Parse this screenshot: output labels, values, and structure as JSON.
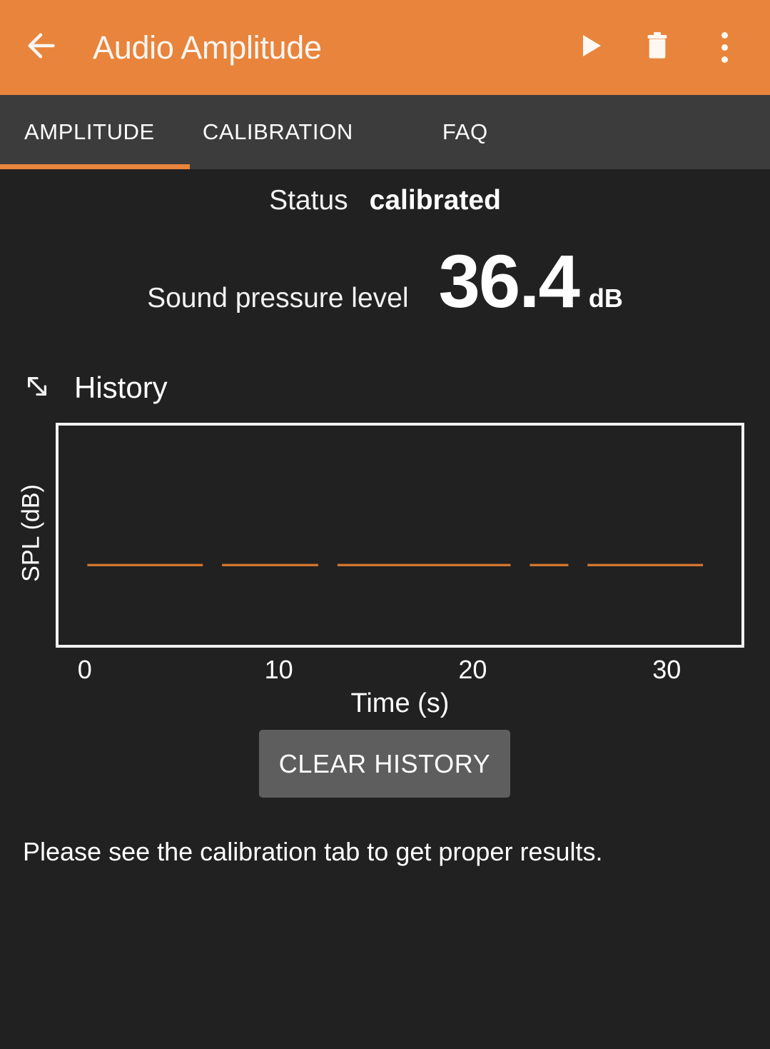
{
  "appbar": {
    "back_icon": "arrow-left-icon",
    "title": "Audio Amplitude",
    "actions": [
      {
        "name": "play-icon",
        "label": "Play"
      },
      {
        "name": "delete-icon",
        "label": "Delete"
      },
      {
        "name": "overflow-menu-icon",
        "label": "More options"
      }
    ],
    "bg_color": "#E8843C",
    "text_color": "#FAF6F2"
  },
  "tabs": {
    "items": [
      {
        "label": "AMPLITUDE",
        "selected": true
      },
      {
        "label": "CALIBRATION",
        "selected": false
      },
      {
        "label": "FAQ",
        "selected": false
      }
    ],
    "bg_color": "#3C3C3C",
    "indicator_color": "#E8843C"
  },
  "status": {
    "label": "Status",
    "value": "calibrated"
  },
  "spl": {
    "label": "Sound pressure level",
    "value": "36.4",
    "unit": "dB"
  },
  "history": {
    "title": "History",
    "expand_icon": "expand-diagonal-icon"
  },
  "clear_button": {
    "label": "CLEAR HISTORY",
    "bg_color": "#5E5E5E"
  },
  "note": {
    "text": "Please see the calibration tab to get proper results."
  },
  "chart_data": {
    "type": "line",
    "title": "History",
    "xlabel": "Time (s)",
    "ylabel": "SPL (dB)",
    "xlim": [
      -1.5,
      34.0
    ],
    "ylim": [
      0,
      100
    ],
    "xticks": [
      0,
      10,
      20,
      30
    ],
    "yticks": [],
    "grid": false,
    "legend": null,
    "line_color": "#D2762E",
    "series": [
      {
        "name": "SPL",
        "x": [
          0.0,
          1.0,
          2.0,
          3.0,
          4.0,
          5.0,
          6.0,
          7.0,
          8.0,
          9.0,
          10.0,
          11.0,
          12.0,
          13.0,
          14.0,
          15.0,
          16.0,
          17.0,
          18.0,
          19.0,
          20.0,
          21.0,
          22.0,
          23.0,
          24.0,
          25.0,
          26.0,
          27.0,
          28.0,
          29.0,
          30.0,
          31.0,
          32.0
        ],
        "values": [
          36.4,
          36.4,
          36.4,
          36.4,
          36.4,
          36.4,
          36.4,
          36.4,
          36.4,
          36.4,
          36.4,
          36.4,
          36.4,
          36.4,
          36.4,
          36.4,
          36.4,
          36.4,
          36.4,
          36.4,
          36.4,
          36.4,
          36.4,
          36.4,
          36.4,
          36.4,
          36.4,
          36.4,
          36.4,
          36.4,
          36.4,
          36.4,
          36.4
        ]
      }
    ],
    "breaks_at_x": [
      6.3,
      12.5,
      22.5,
      25.6
    ]
  }
}
